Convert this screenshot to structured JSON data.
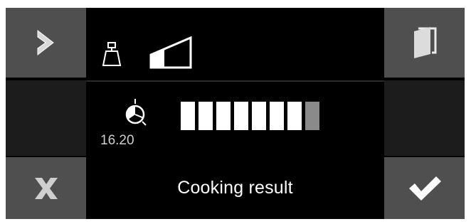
{
  "time": "16.20",
  "result_label": "Cooking result",
  "progress": {
    "filled": 7,
    "total": 8
  },
  "icons": {
    "next": "chevron-right-icon",
    "cancel": "close-icon",
    "door": "door-icon",
    "confirm": "checkmark-icon",
    "weight": "weight-icon",
    "level": "level-ramp-icon",
    "timer": "timer-icon"
  },
  "colors": {
    "button": "#4f4f4f",
    "panel": "#000000",
    "progress_filled": "#ffffff",
    "progress_empty": "#8a8a8a"
  }
}
